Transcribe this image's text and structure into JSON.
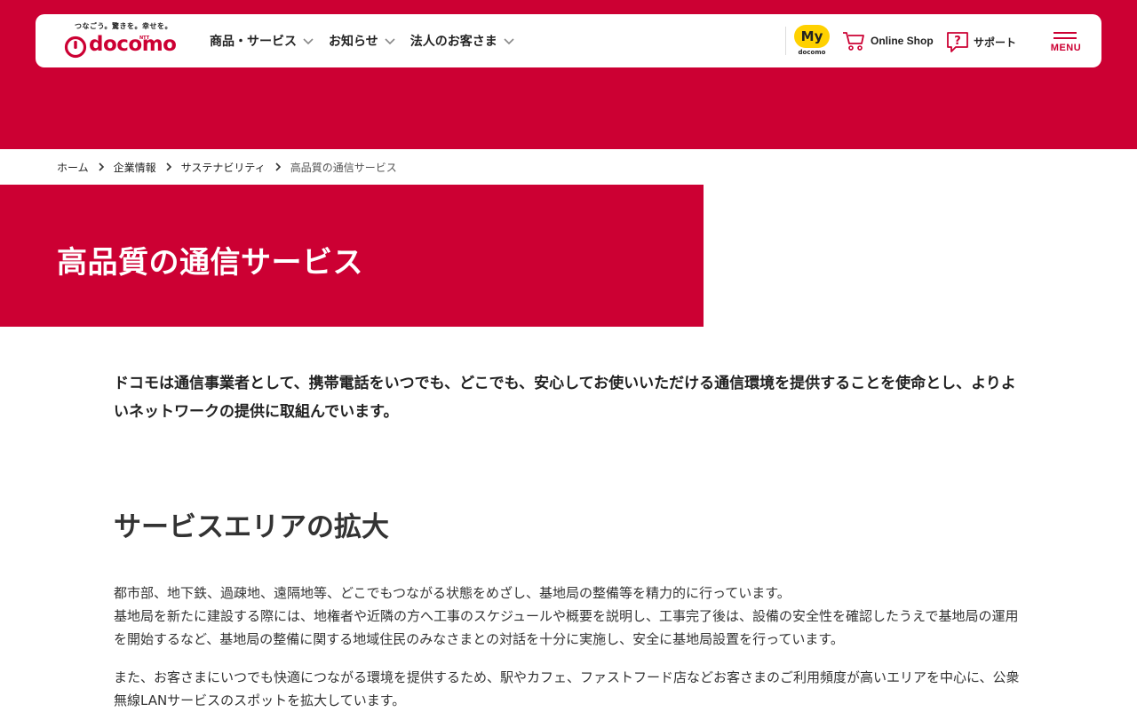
{
  "header": {
    "logo": {
      "tagline": "つなごう。驚きを。幸せを。",
      "ntt": "NTT",
      "wordmark": "docomo",
      "color": "#cc0033"
    },
    "nav": [
      {
        "label": "商品・サービス",
        "icon": "chevron-down-icon"
      },
      {
        "label": "お知らせ",
        "icon": "chevron-down-icon"
      },
      {
        "label": "法人のお客さま",
        "icon": "chevron-down-icon"
      }
    ],
    "mydocomo": {
      "label": "My",
      "sub": "docomo",
      "color": "#ffd100"
    },
    "online_shop": {
      "label": "Online Shop",
      "icon": "cart-icon"
    },
    "support": {
      "label": "サポート",
      "icon": "help-icon"
    },
    "menu": {
      "label": "MENU",
      "icon": "hamburger-icon"
    }
  },
  "breadcrumb": [
    {
      "label": "ホーム"
    },
    {
      "label": "企業情報"
    },
    {
      "label": "サステナビリティ"
    },
    {
      "label": "高品質の通信サービス"
    }
  ],
  "hero": {
    "title": "高品質の通信サービス"
  },
  "lead": "ドコモは通信事業者として、携帯電話をいつでも、どこでも、安心してお使いいただける通信環境を提供することを使命とし、よりよいネットワークの提供に取組んでいます。",
  "section": {
    "title": "サービスエリアの拡大",
    "paragraphs": [
      "都市部、地下鉄、過疎地、遠隔地等、どこでもつながる状態をめざし、基地局の整備等を精力的に行っています。",
      "基地局を新たに建設する際には、地権者や近隣の方へ工事のスケジュールや概要を説明し、工事完了後は、設備の安全性を確認したうえで基地局の運用を開始するなど、基地局の整備に関する地域住民のみなさまとの対話を十分に実施し、安全に基地局設置を行っています。",
      "また、お客さまにいつでも快適につながる環境を提供するため、駅やカフェ、ファストフード店などお客さまのご利用頻度が高いエリアを中心に、公衆無線LANサービスのスポットを拡大しています。"
    ]
  },
  "colors": {
    "brand_red": "#cc0033",
    "text": "#222222"
  }
}
